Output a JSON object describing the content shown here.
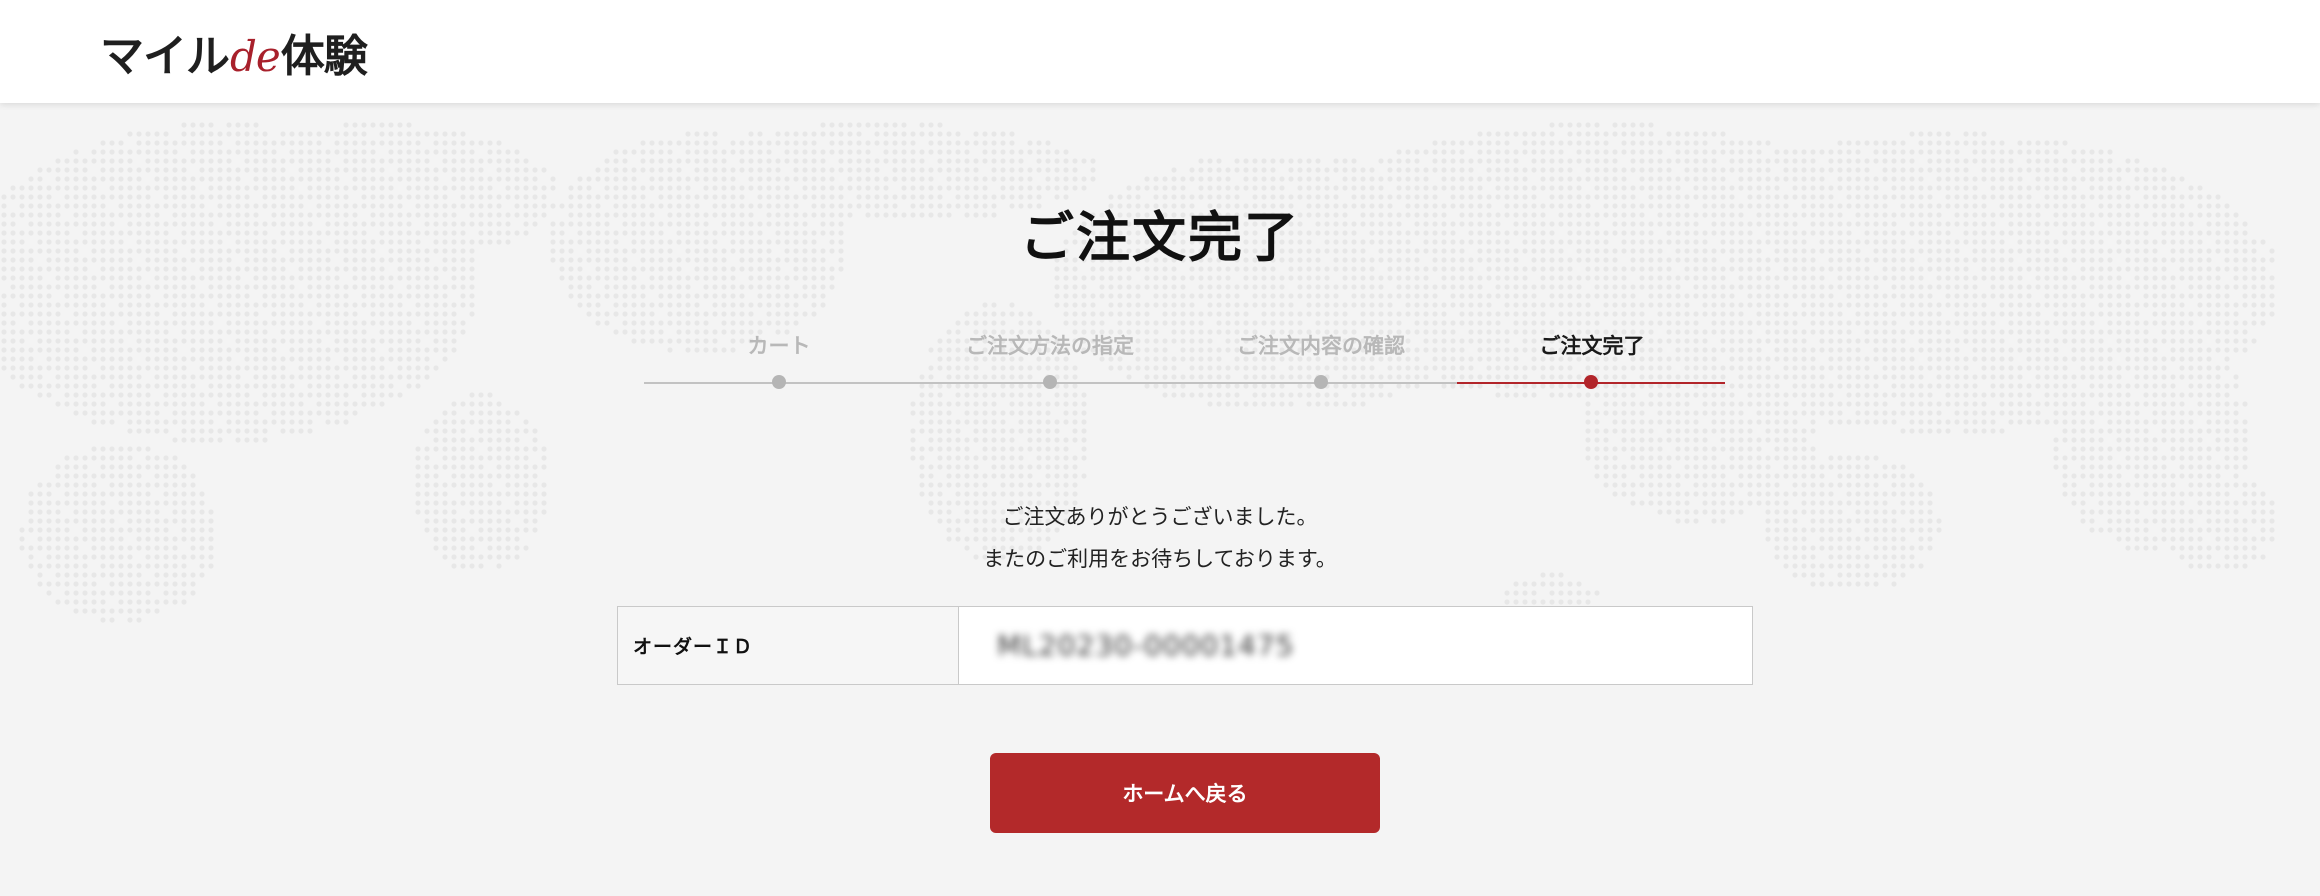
{
  "header": {
    "logo": {
      "part1": "マイル",
      "part2": "de",
      "part3": "体験"
    }
  },
  "page": {
    "title": "ご注文完了",
    "steps": [
      {
        "label": "カート",
        "state": "inactive"
      },
      {
        "label": "ご注文方法の指定",
        "state": "inactive"
      },
      {
        "label": "ご注文内容の確認",
        "state": "inactive"
      },
      {
        "label": "ご注文完了",
        "state": "active"
      }
    ],
    "message": {
      "line1": "ご注文ありがとうございました。",
      "line2": "またのご利用をお待ちしております。"
    },
    "order": {
      "label": "オーダーＩＤ",
      "value": "ML20230-00001475"
    },
    "home_button": "ホームへ戻る"
  },
  "colors": {
    "accent": "#b3292a",
    "inactive": "#b8b8b8",
    "background": "#f4f4f4"
  }
}
